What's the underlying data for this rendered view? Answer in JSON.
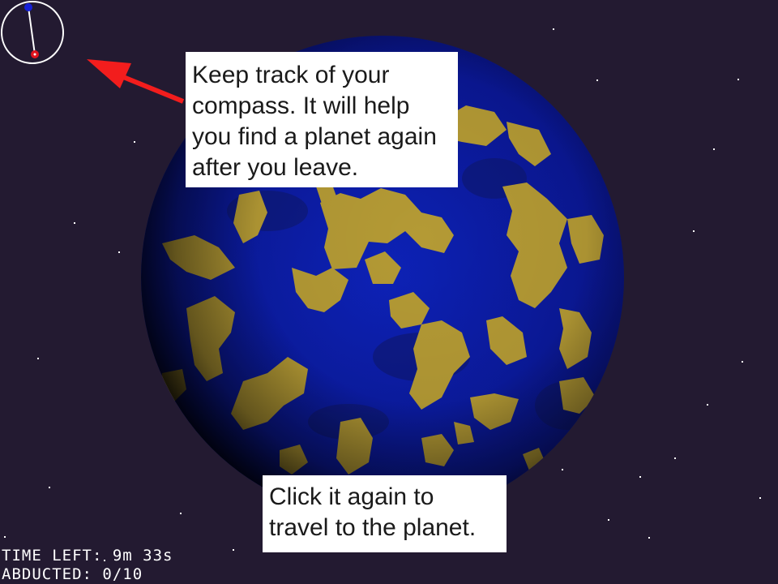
{
  "hud": {
    "time_left_label": "TIME LEFT:",
    "time_left_value": "9m 33s",
    "abducted_label": "ABDUCTED:",
    "abducted_value": "0/10",
    "abducted_count": 0,
    "abducted_total": 10
  },
  "tooltips": {
    "compass": "Keep track of your compass. It will help you find a planet again after you leave.",
    "travel": "Click it again to travel to the planet."
  },
  "colors": {
    "space": "#231a31",
    "ocean": "#0b1cab",
    "land": "#b49a35",
    "arrow": "#f21d1d",
    "compass_ring": "#ffffff",
    "compass_player": "#e0131d",
    "compass_target": "#1620d8"
  },
  "icons": {
    "compass": "compass-icon",
    "arrow": "pointer-arrow-icon"
  }
}
